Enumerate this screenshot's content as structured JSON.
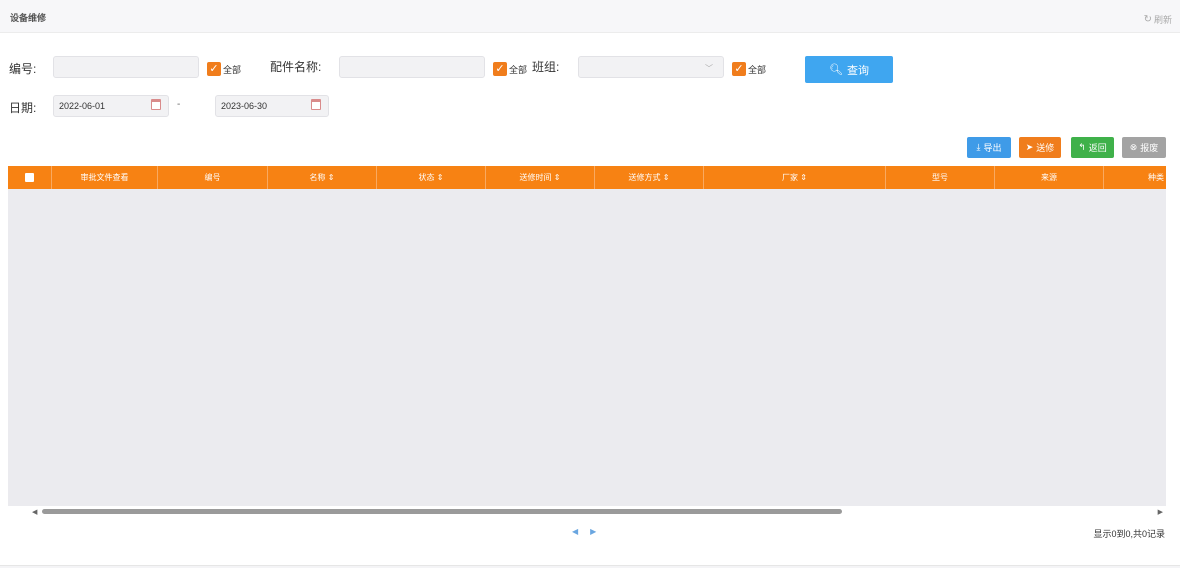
{
  "window": {
    "title": "设备维修",
    "refresh_label": "刷新",
    "refresh_icon": "refresh-icon"
  },
  "filters": {
    "code_label": "编号:",
    "code_value": "",
    "part_label": "配件名称:",
    "part_value": "",
    "team_label": "班组:",
    "team_value": "",
    "all_label": "全部",
    "date_label": "日期:",
    "date_from": "2022-06-01",
    "date_sep": "-",
    "date_to": "2023-06-30",
    "query_label": "查询"
  },
  "toolbar": {
    "export_label": "导出",
    "repair_label": "送修",
    "back_label": "返回",
    "scrap_label": "报废"
  },
  "colors": {
    "accent": "#f78213",
    "primary": "#3fa6f0",
    "success": "#3fb14a",
    "muted": "#a3a3a3"
  },
  "table": {
    "columns": [
      "审批文件查看",
      "编号",
      "名称 ⇕",
      "状态 ⇕",
      "送修时间 ⇕",
      "送修方式 ⇕",
      "厂家 ⇕",
      "型号",
      "来源",
      "种类"
    ],
    "rows": []
  },
  "footer": {
    "prev": "◀",
    "next": "▶",
    "info": "显示0到0,共0记录"
  }
}
